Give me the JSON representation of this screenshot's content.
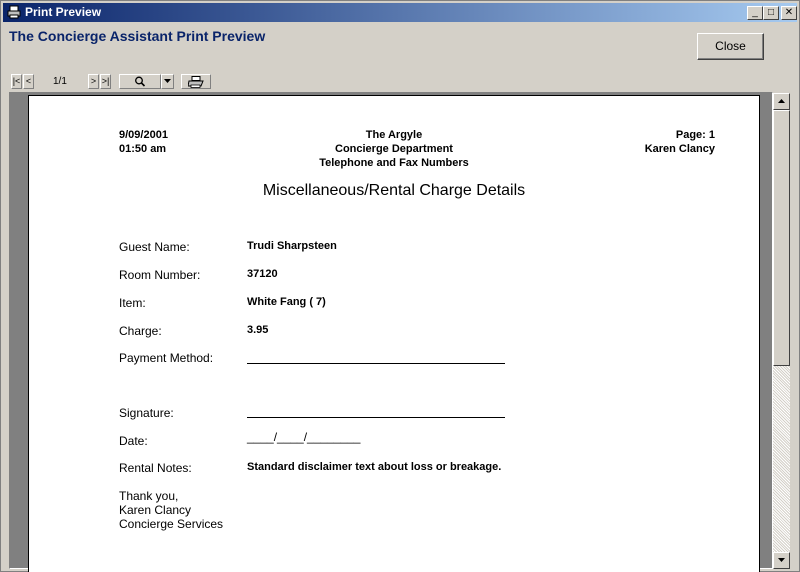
{
  "window": {
    "title": "Print Preview",
    "min_label": "_",
    "max_label": "□",
    "close_label": "✕"
  },
  "header": {
    "heading": "The Concierge Assistant Print Preview",
    "close_button": "Close"
  },
  "toolbar": {
    "first_label": "|<",
    "prev_label": "<",
    "page_indicator": "1/1",
    "next_label": ">",
    "last_label": ">|",
    "zoom_icon": "magnifier-icon",
    "dropdown_icon": "chevron-down-icon",
    "print_icon": "printer-icon"
  },
  "report": {
    "date": "9/09/2001",
    "time": "01:50 am",
    "org": "The Argyle",
    "dept": "Concierge Department",
    "subtitle": "Telephone and Fax Numbers",
    "page": "Page: 1",
    "user": "Karen Clancy",
    "title": "Miscellaneous/Rental Charge Details",
    "fields": {
      "guest_label": "Guest Name:",
      "guest_value": "Trudi Sharpsteen",
      "room_label": "Room Number:",
      "room_value": "37120",
      "item_label": "Item:",
      "item_value": "White Fang  ( 7)",
      "charge_label": "Charge:",
      "charge_value": "3.95",
      "payment_label": "Payment Method:",
      "signature_label": "Signature:",
      "date_label": "Date:",
      "date_value": "____/____/________",
      "notes_label": "Rental Notes:",
      "notes_value": "Standard disclaimer text about loss or breakage."
    },
    "closing": {
      "line1": "Thank you,",
      "line2": "Karen Clancy",
      "line3": "Concierge Services"
    }
  }
}
